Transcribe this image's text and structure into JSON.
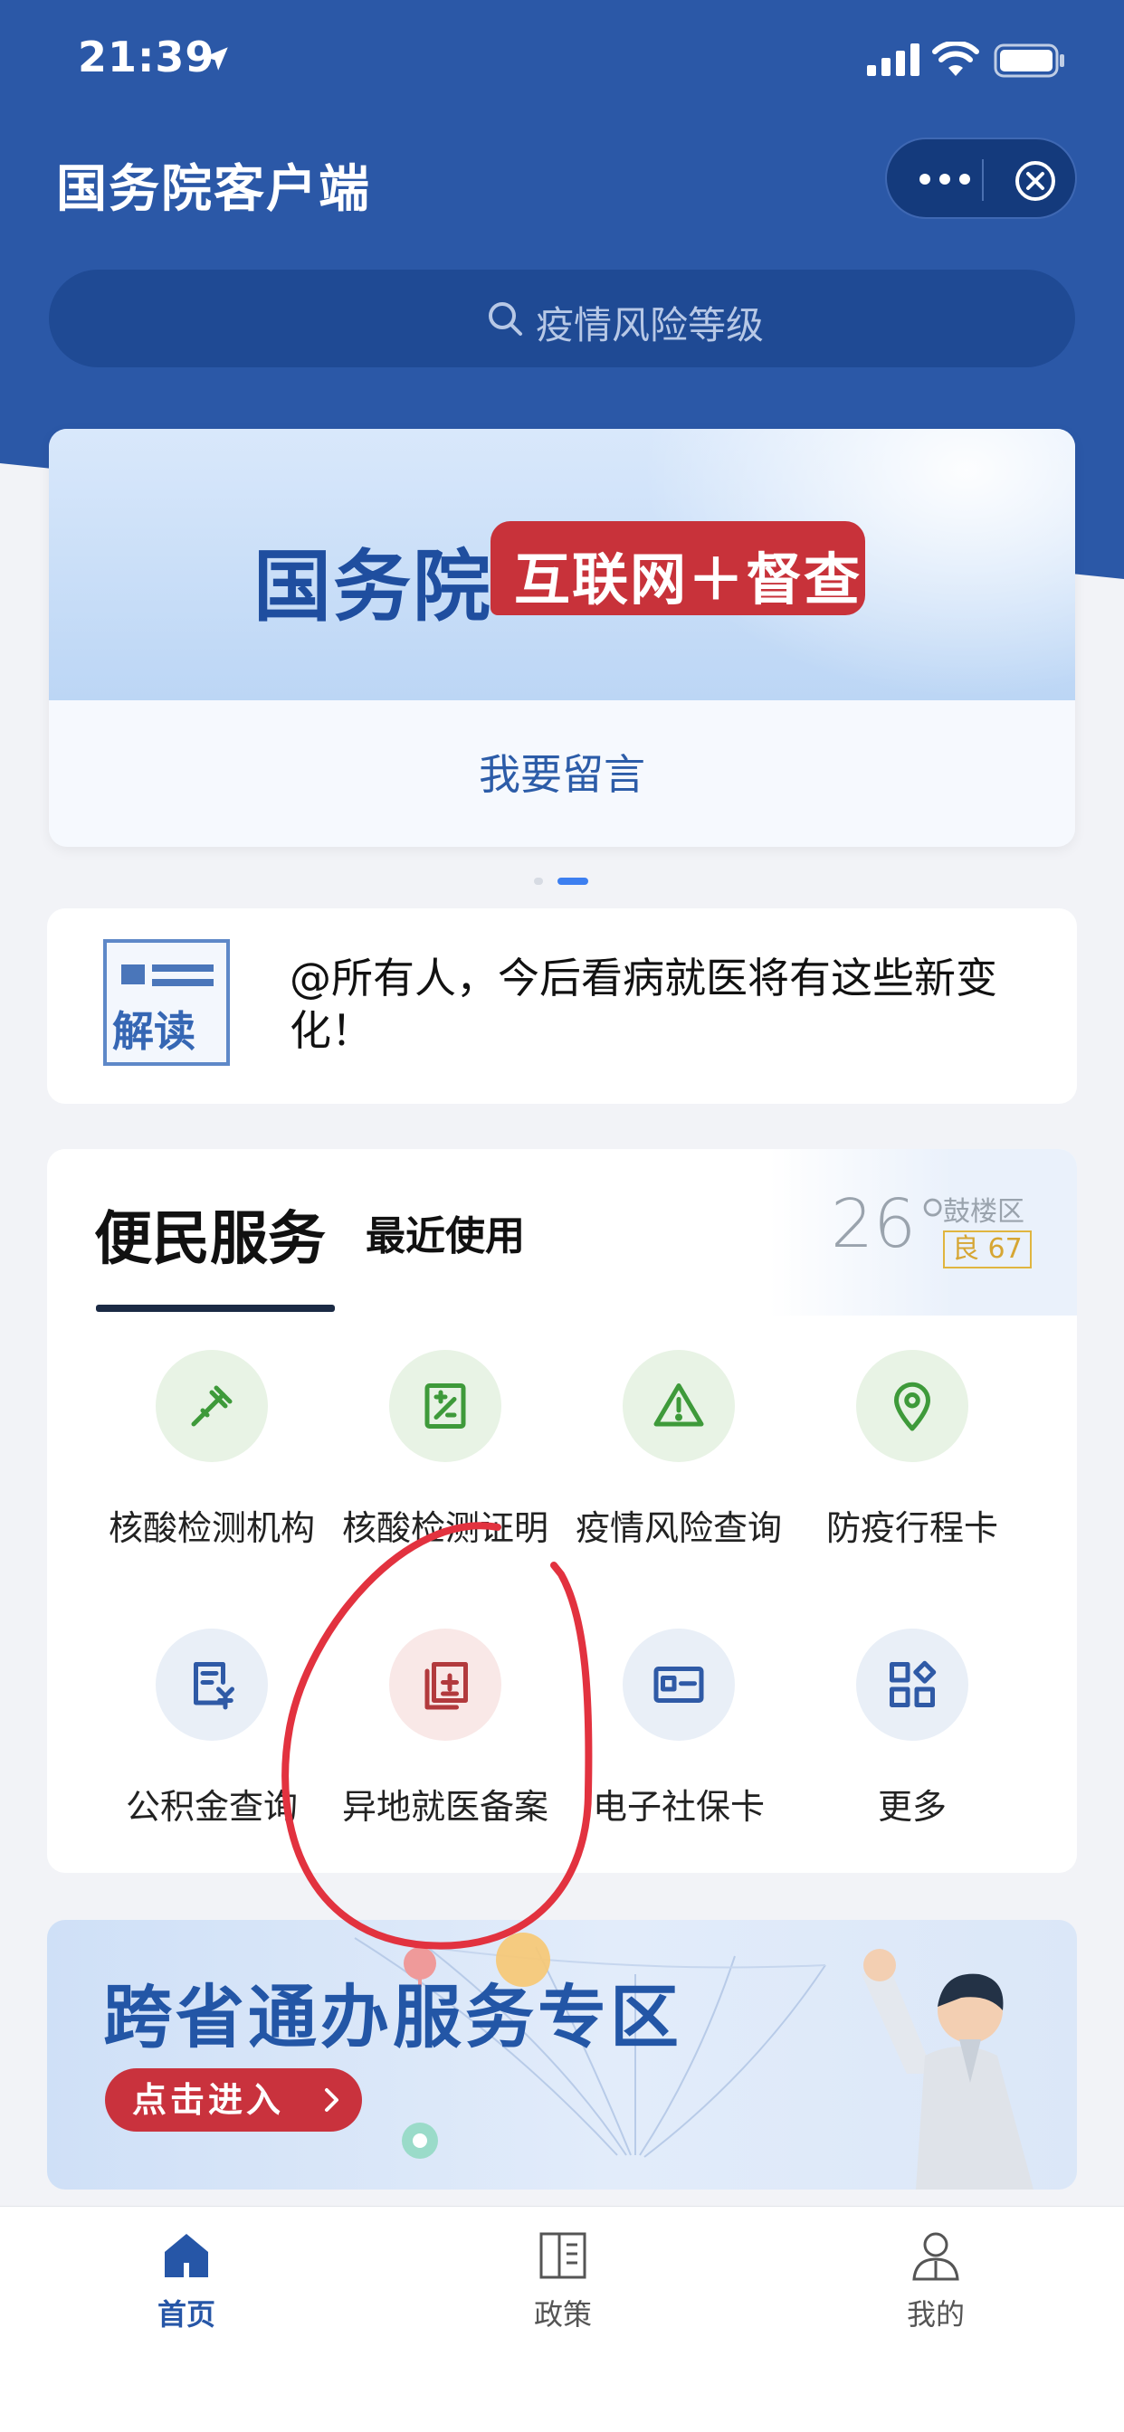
{
  "status_bar": {
    "time": "21:39",
    "icons": [
      "location-arrow-icon",
      "signal-icon",
      "wifi-icon",
      "battery-icon"
    ]
  },
  "header": {
    "title": "国务院客户端",
    "capsule_icons": [
      "more-dots-icon",
      "close-icon"
    ]
  },
  "search": {
    "placeholder": "疫情风险等级"
  },
  "banner": {
    "headline": "国务院",
    "tag": "互联网＋督查",
    "message": "我要留言",
    "carousel_count": 2,
    "carousel_active": 2
  },
  "news": {
    "icon_text": "解读",
    "title": "@所有人，今后看病就医将有这些新变化！"
  },
  "services": {
    "tab_active": "便民服务",
    "tab_other": "最近使用",
    "weather": {
      "temperature": "26°",
      "district": "鼓楼区",
      "aqi": "良 67"
    },
    "items": [
      {
        "label": "核酸检测机构",
        "icon": "dropper-icon",
        "tone": "green"
      },
      {
        "label": "核酸检测证明",
        "icon": "certificate-icon",
        "tone": "green"
      },
      {
        "label": "疫情风险查询",
        "icon": "warning-icon",
        "tone": "green"
      },
      {
        "label": "防疫行程卡",
        "icon": "location-pin-icon",
        "tone": "green"
      },
      {
        "label": "公积金查询",
        "icon": "fund-document-icon",
        "tone": "blue"
      },
      {
        "label": "异地就医备案",
        "icon": "medical-record-icon",
        "tone": "pink"
      },
      {
        "label": "电子社保卡",
        "icon": "id-card-icon",
        "tone": "blue"
      },
      {
        "label": "更多",
        "icon": "more-grid-icon",
        "tone": "blue"
      }
    ]
  },
  "promo": {
    "title": "跨省通办服务专区",
    "button": "点击进入"
  },
  "tabbar": {
    "home": "首页",
    "policy": "政策",
    "mine": "我的"
  },
  "colors": {
    "brand_blue": "#2b58a7",
    "accent_red": "#c8323a",
    "annotation_red": "#e2323f"
  }
}
